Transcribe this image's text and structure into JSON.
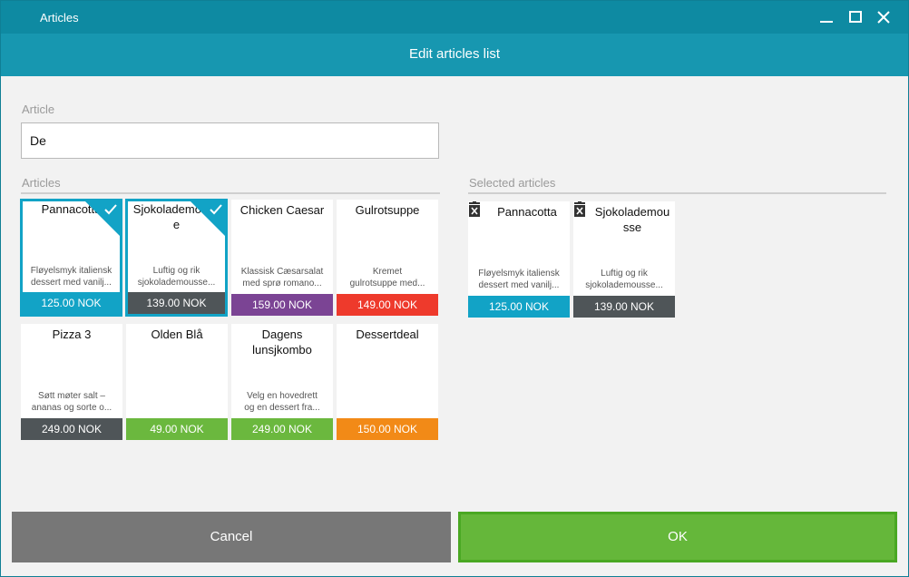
{
  "window": {
    "title": "Articles"
  },
  "header": {
    "title": "Edit articles list"
  },
  "search": {
    "label": "Article",
    "value": "De"
  },
  "articles": {
    "label": "Articles",
    "items": [
      {
        "name": "Pannacotta",
        "desc": "Fløyelsmyk italiensk\ndessert med vanilj...",
        "price": "125.00 NOK",
        "color": "#12a3c6",
        "selected": true
      },
      {
        "name": "Sjokolademousse",
        "desc": "Luftig og rik\nsjokolademousse...",
        "price": "139.00 NOK",
        "color": "#4f5558",
        "selected": true
      },
      {
        "name": "Chicken Caesar",
        "desc": "Klassisk Cæsarsalat\nmed sprø romano...",
        "price": "159.00 NOK",
        "color": "#7b4494",
        "selected": false
      },
      {
        "name": "Gulrotsuppe",
        "desc": "Kremet\ngulrotsuppe med...",
        "price": "149.00 NOK",
        "color": "#ee3a2c",
        "selected": false
      },
      {
        "name": "Pizza 3",
        "desc": "Søtt møter salt –\nananas og sorte o...",
        "price": "249.00 NOK",
        "color": "#4f5558",
        "selected": false
      },
      {
        "name": "Olden Blå",
        "desc": "",
        "price": "49.00 NOK",
        "color": "#6bb83e",
        "selected": false
      },
      {
        "name": "Dagens\nlunsjkombo",
        "desc": "Velg en hovedrett\nog en dessert fra...",
        "price": "249.00 NOK",
        "color": "#6bb83e",
        "selected": false
      },
      {
        "name": "Dessertdeal",
        "desc": "",
        "price": "150.00 NOK",
        "color": "#f28a17",
        "selected": false
      }
    ]
  },
  "selected_articles": {
    "label": "Selected articles",
    "items": [
      {
        "name": "Pannacotta",
        "desc": "Fløyelsmyk italiensk\ndessert med vanilj...",
        "price": "125.00 NOK",
        "color": "#12a3c6"
      },
      {
        "name": "Sjokolademousse",
        "desc": "Luftig og rik\nsjokolademousse...",
        "price": "139.00 NOK",
        "color": "#4f5558"
      }
    ]
  },
  "footer": {
    "cancel_label": "Cancel",
    "ok_label": "OK"
  }
}
